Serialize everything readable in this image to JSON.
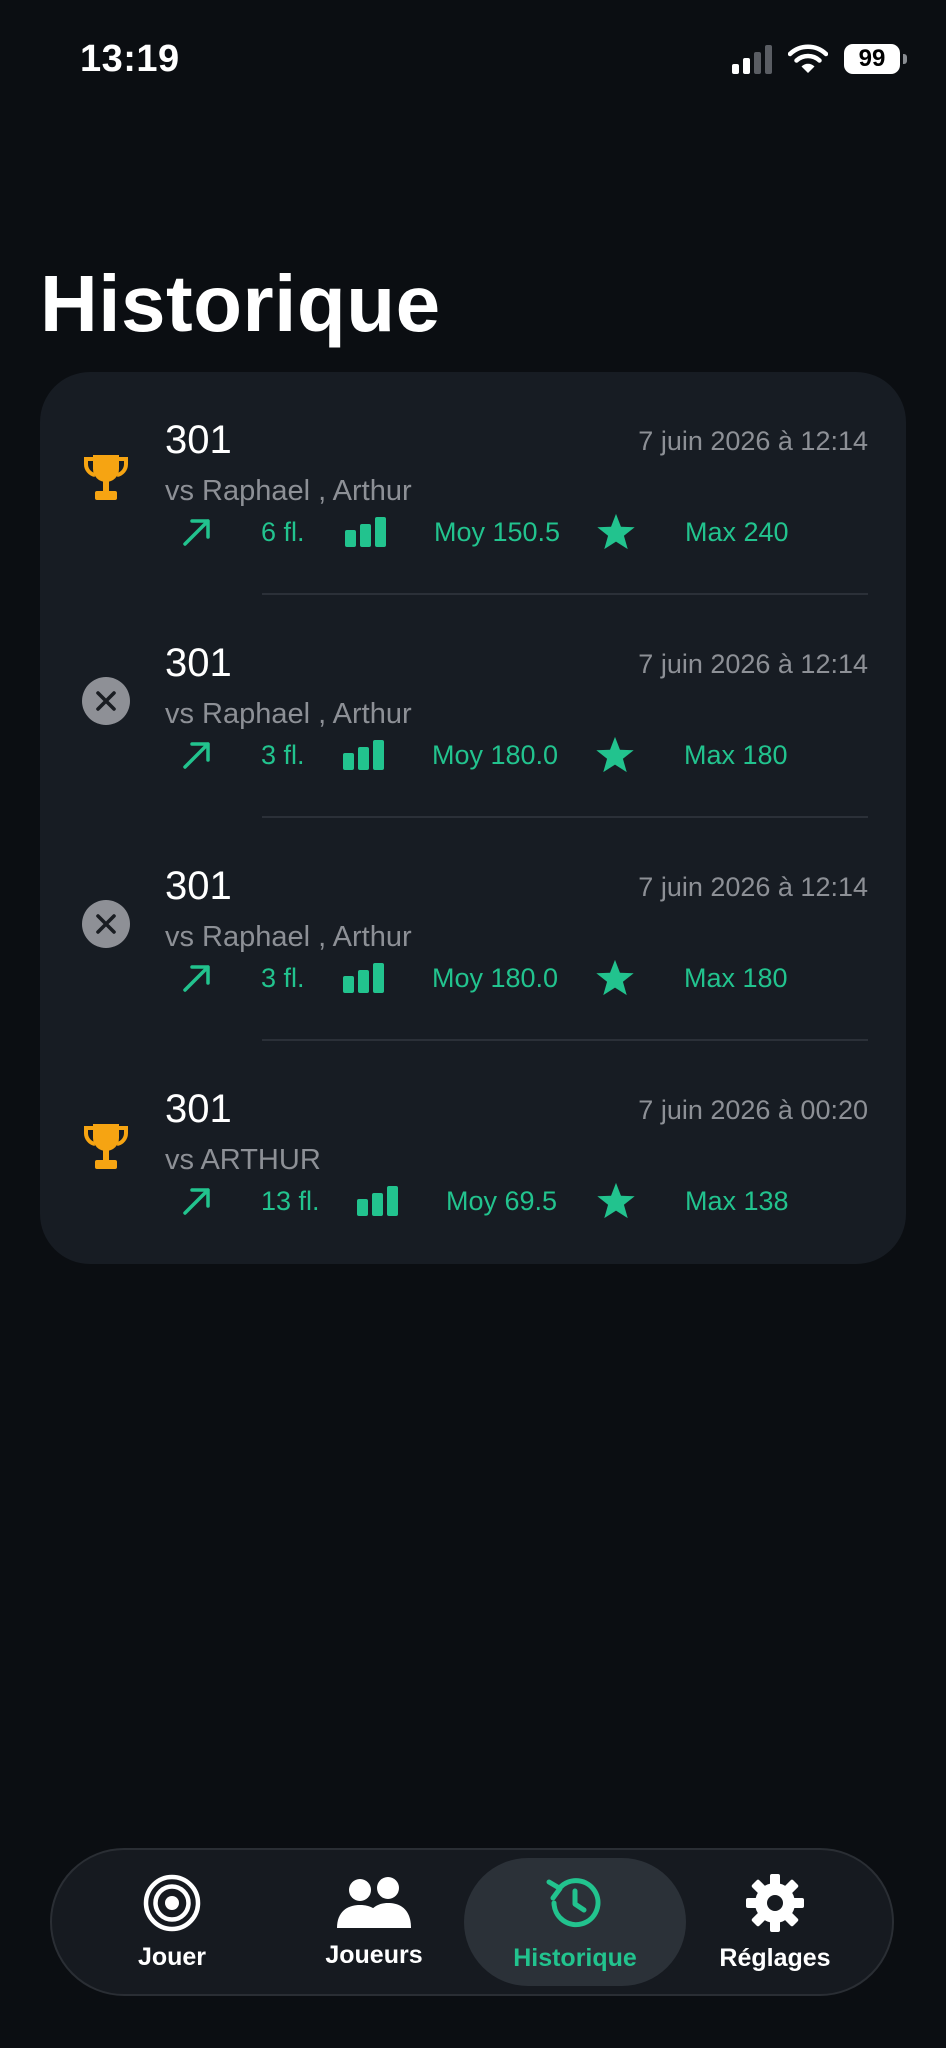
{
  "status_bar": {
    "time": "13:19",
    "battery": "99"
  },
  "page": {
    "title": "Historique"
  },
  "games": [
    {
      "mode": "301",
      "date": "7 juin 2026 à 12:14",
      "opponents": "vs Raphael , Arthur",
      "result": "win",
      "result_icon": "trophy-icon",
      "darts": "6 fl.",
      "average": "Moy 150.5",
      "max": "Max 240"
    },
    {
      "mode": "301",
      "date": "7 juin 2026 à 12:14",
      "opponents": "vs Raphael , Arthur",
      "result": "loss",
      "result_icon": "close-circle-icon",
      "darts": "3 fl.",
      "average": "Moy 180.0",
      "max": "Max 180"
    },
    {
      "mode": "301",
      "date": "7 juin 2026 à 12:14",
      "opponents": "vs Raphael , Arthur",
      "result": "loss",
      "result_icon": "close-circle-icon",
      "darts": "3 fl.",
      "average": "Moy 180.0",
      "max": "Max 180"
    },
    {
      "mode": "301",
      "date": "7 juin 2026 à 00:20",
      "opponents": "vs ARTHUR",
      "result": "win",
      "result_icon": "trophy-icon",
      "darts": "13 fl.",
      "average": "Moy 69.5",
      "max": "Max 138"
    }
  ],
  "tab_bar": {
    "tabs": [
      {
        "label": "Jouer",
        "icon": "target-icon",
        "active": false
      },
      {
        "label": "Joueurs",
        "icon": "people-icon",
        "active": false
      },
      {
        "label": "Historique",
        "icon": "history-icon",
        "active": true
      },
      {
        "label": "Réglages",
        "icon": "gear-icon",
        "active": false
      }
    ]
  },
  "colors": {
    "accent": "#22c38e",
    "trophy": "#f6a412",
    "background": "#0b0e12",
    "card": "#171c23",
    "secondary_text": "#8d9096"
  }
}
